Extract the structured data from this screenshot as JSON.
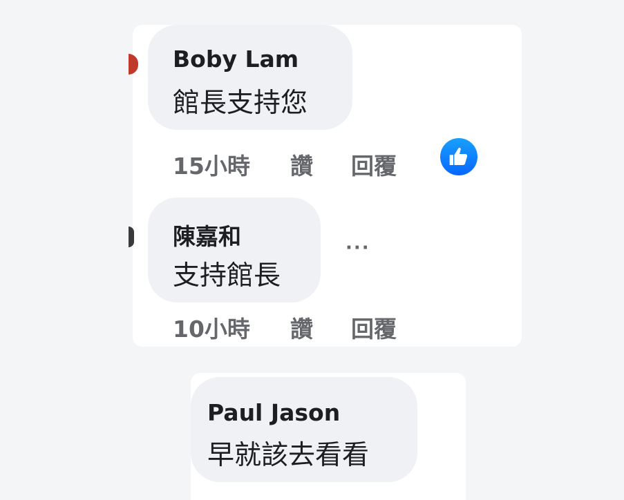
{
  "comments": [
    {
      "author": "Boby Lam",
      "text": "館長支持您",
      "time": "15小時",
      "like_label": "讚",
      "reply_label": "回覆",
      "reaction_icon": "thumbs-up-icon"
    },
    {
      "author": "陳嘉和",
      "text": "支持館長",
      "time": "10小時",
      "like_label": "讚",
      "reply_label": "回覆",
      "more_label": "···"
    },
    {
      "author": "Paul Jason",
      "text": "早就該去看看"
    }
  ],
  "colors": {
    "background": "#f4f5f6",
    "card": "#ffffff",
    "bubble": "#eff1f4",
    "primary_text": "#1c1e21",
    "secondary_text": "#65676b",
    "like_blue": "#0866ff"
  }
}
